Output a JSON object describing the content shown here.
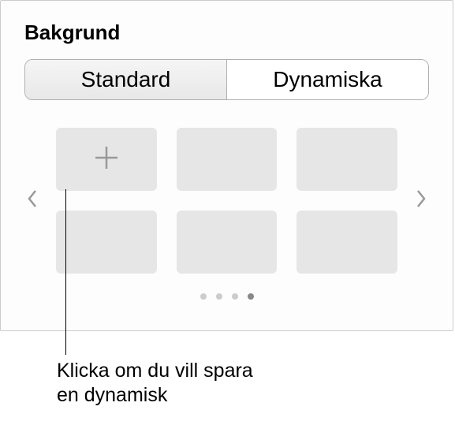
{
  "title": "Bakgrund",
  "tabs": {
    "standard": "Standard",
    "dynamic": "Dynamiska"
  },
  "callout": "Klicka om du vill spara en dynamisk",
  "dots": {
    "count": 4,
    "activeIndex": 3
  }
}
